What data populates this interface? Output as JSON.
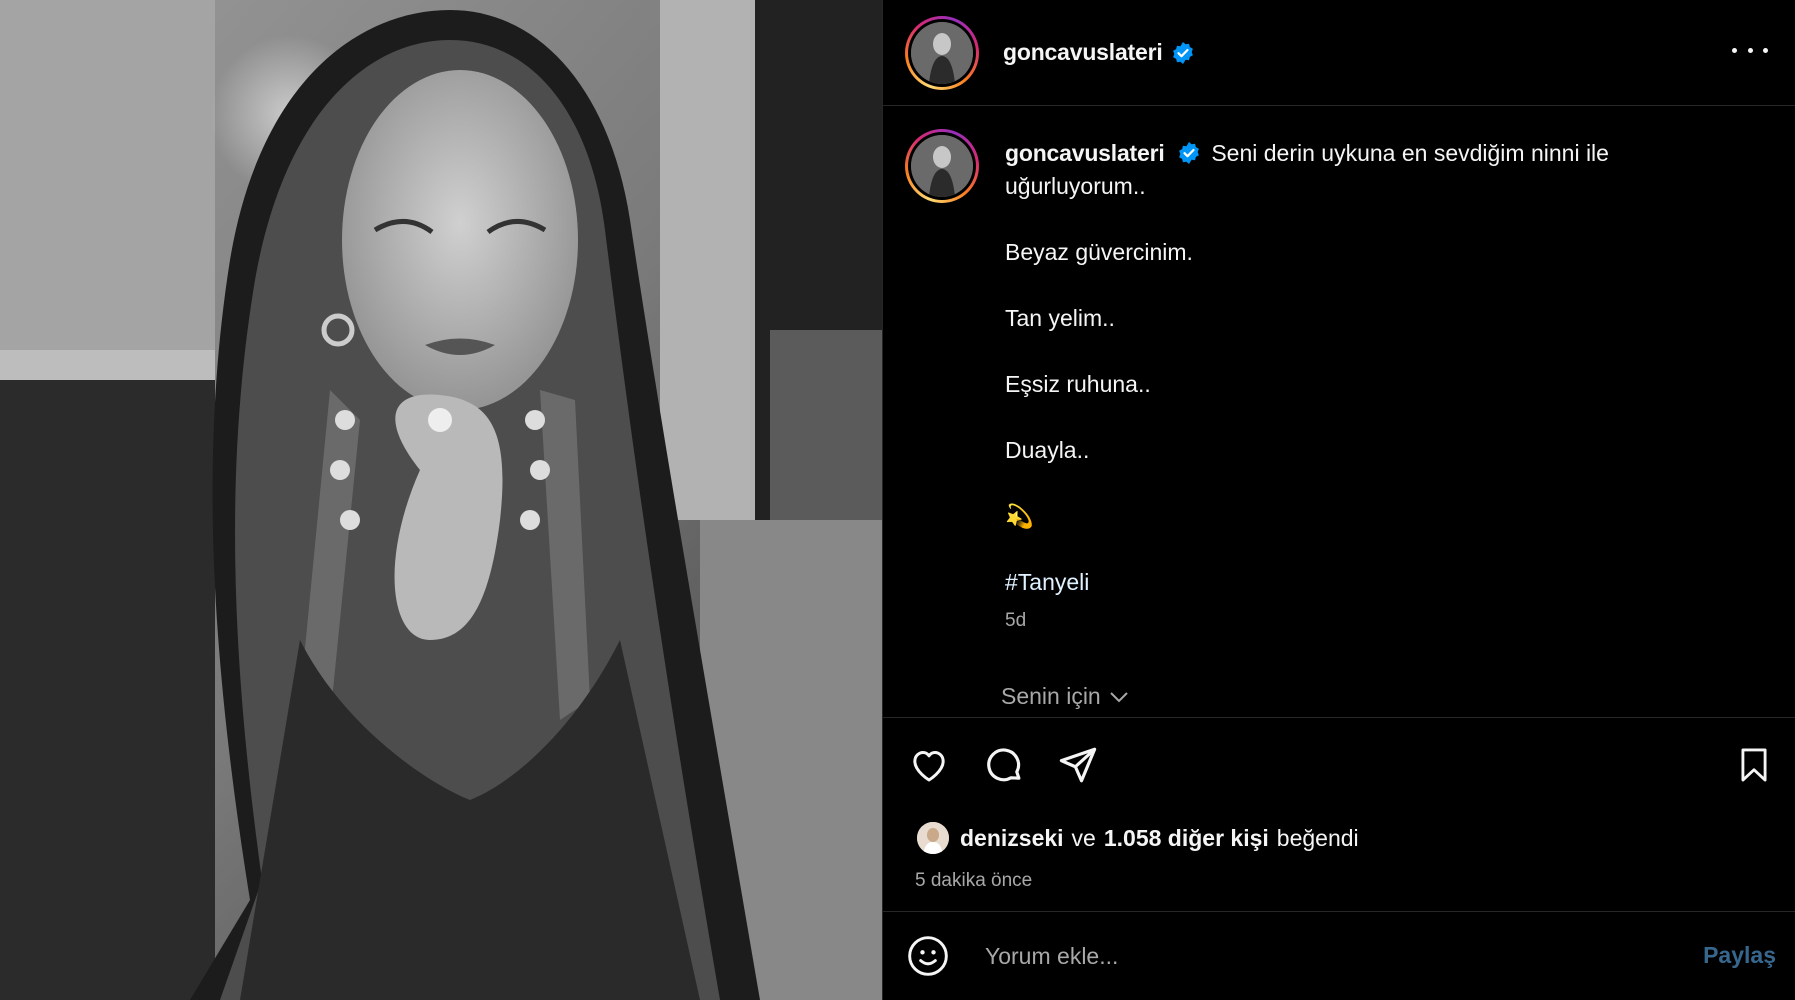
{
  "post": {
    "author": "goncavuslateri",
    "verified": true,
    "caption_lines": [
      "Seni derin uykuna en sevdiğim ninni ile",
      "uğurluyorum..",
      "Beyaz güvercinim.",
      "Tan yelim..",
      "Eşsiz ruhuna..",
      "Duayla..",
      "💫",
      "#Tanyeli"
    ],
    "posted_ago": "5d",
    "for_you_label": "Senin için"
  },
  "likes": {
    "first_liker": "denizseki",
    "connector": "ve",
    "others": "1.058 diğer kişi",
    "suffix": "beğendi",
    "time": "5 dakika önce"
  },
  "comment": {
    "placeholder": "Yorum ekle...",
    "post_label": "Paylaş"
  },
  "icons": {
    "more": "more-horizontal-icon",
    "like": "heart-icon",
    "comment": "comment-icon",
    "share": "send-icon",
    "save": "bookmark-icon",
    "emoji": "emoji-icon",
    "chevron": "chevron-down-icon"
  },
  "colors": {
    "background": "#000000",
    "verified": "#0095f6",
    "post_button": "#38678e",
    "muted": "#a8a8a8"
  }
}
